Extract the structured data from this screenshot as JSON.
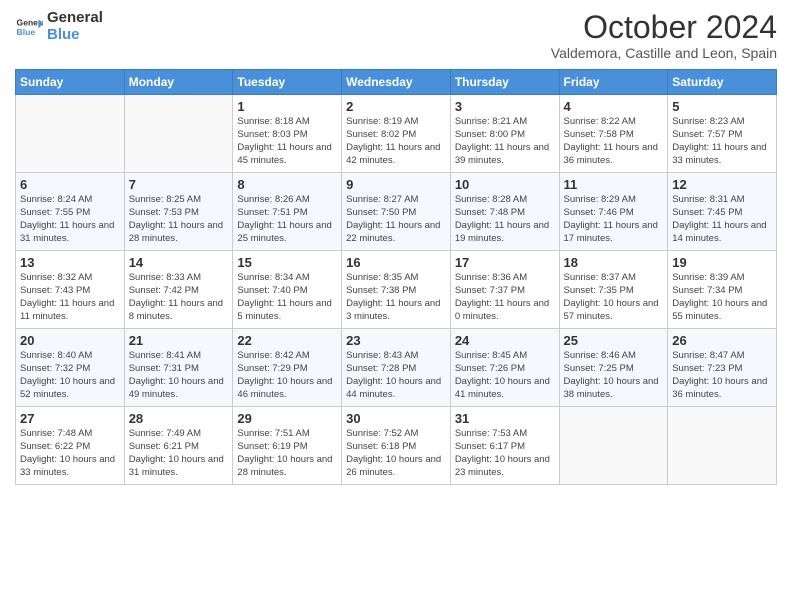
{
  "header": {
    "logo_line1": "General",
    "logo_line2": "Blue",
    "month": "October 2024",
    "location": "Valdemora, Castille and Leon, Spain"
  },
  "days_of_week": [
    "Sunday",
    "Monday",
    "Tuesday",
    "Wednesday",
    "Thursday",
    "Friday",
    "Saturday"
  ],
  "weeks": [
    [
      {
        "day": "",
        "text": ""
      },
      {
        "day": "",
        "text": ""
      },
      {
        "day": "1",
        "text": "Sunrise: 8:18 AM\nSunset: 8:03 PM\nDaylight: 11 hours and 45 minutes."
      },
      {
        "day": "2",
        "text": "Sunrise: 8:19 AM\nSunset: 8:02 PM\nDaylight: 11 hours and 42 minutes."
      },
      {
        "day": "3",
        "text": "Sunrise: 8:21 AM\nSunset: 8:00 PM\nDaylight: 11 hours and 39 minutes."
      },
      {
        "day": "4",
        "text": "Sunrise: 8:22 AM\nSunset: 7:58 PM\nDaylight: 11 hours and 36 minutes."
      },
      {
        "day": "5",
        "text": "Sunrise: 8:23 AM\nSunset: 7:57 PM\nDaylight: 11 hours and 33 minutes."
      }
    ],
    [
      {
        "day": "6",
        "text": "Sunrise: 8:24 AM\nSunset: 7:55 PM\nDaylight: 11 hours and 31 minutes."
      },
      {
        "day": "7",
        "text": "Sunrise: 8:25 AM\nSunset: 7:53 PM\nDaylight: 11 hours and 28 minutes."
      },
      {
        "day": "8",
        "text": "Sunrise: 8:26 AM\nSunset: 7:51 PM\nDaylight: 11 hours and 25 minutes."
      },
      {
        "day": "9",
        "text": "Sunrise: 8:27 AM\nSunset: 7:50 PM\nDaylight: 11 hours and 22 minutes."
      },
      {
        "day": "10",
        "text": "Sunrise: 8:28 AM\nSunset: 7:48 PM\nDaylight: 11 hours and 19 minutes."
      },
      {
        "day": "11",
        "text": "Sunrise: 8:29 AM\nSunset: 7:46 PM\nDaylight: 11 hours and 17 minutes."
      },
      {
        "day": "12",
        "text": "Sunrise: 8:31 AM\nSunset: 7:45 PM\nDaylight: 11 hours and 14 minutes."
      }
    ],
    [
      {
        "day": "13",
        "text": "Sunrise: 8:32 AM\nSunset: 7:43 PM\nDaylight: 11 hours and 11 minutes."
      },
      {
        "day": "14",
        "text": "Sunrise: 8:33 AM\nSunset: 7:42 PM\nDaylight: 11 hours and 8 minutes."
      },
      {
        "day": "15",
        "text": "Sunrise: 8:34 AM\nSunset: 7:40 PM\nDaylight: 11 hours and 5 minutes."
      },
      {
        "day": "16",
        "text": "Sunrise: 8:35 AM\nSunset: 7:38 PM\nDaylight: 11 hours and 3 minutes."
      },
      {
        "day": "17",
        "text": "Sunrise: 8:36 AM\nSunset: 7:37 PM\nDaylight: 11 hours and 0 minutes."
      },
      {
        "day": "18",
        "text": "Sunrise: 8:37 AM\nSunset: 7:35 PM\nDaylight: 10 hours and 57 minutes."
      },
      {
        "day": "19",
        "text": "Sunrise: 8:39 AM\nSunset: 7:34 PM\nDaylight: 10 hours and 55 minutes."
      }
    ],
    [
      {
        "day": "20",
        "text": "Sunrise: 8:40 AM\nSunset: 7:32 PM\nDaylight: 10 hours and 52 minutes."
      },
      {
        "day": "21",
        "text": "Sunrise: 8:41 AM\nSunset: 7:31 PM\nDaylight: 10 hours and 49 minutes."
      },
      {
        "day": "22",
        "text": "Sunrise: 8:42 AM\nSunset: 7:29 PM\nDaylight: 10 hours and 46 minutes."
      },
      {
        "day": "23",
        "text": "Sunrise: 8:43 AM\nSunset: 7:28 PM\nDaylight: 10 hours and 44 minutes."
      },
      {
        "day": "24",
        "text": "Sunrise: 8:45 AM\nSunset: 7:26 PM\nDaylight: 10 hours and 41 minutes."
      },
      {
        "day": "25",
        "text": "Sunrise: 8:46 AM\nSunset: 7:25 PM\nDaylight: 10 hours and 38 minutes."
      },
      {
        "day": "26",
        "text": "Sunrise: 8:47 AM\nSunset: 7:23 PM\nDaylight: 10 hours and 36 minutes."
      }
    ],
    [
      {
        "day": "27",
        "text": "Sunrise: 7:48 AM\nSunset: 6:22 PM\nDaylight: 10 hours and 33 minutes."
      },
      {
        "day": "28",
        "text": "Sunrise: 7:49 AM\nSunset: 6:21 PM\nDaylight: 10 hours and 31 minutes."
      },
      {
        "day": "29",
        "text": "Sunrise: 7:51 AM\nSunset: 6:19 PM\nDaylight: 10 hours and 28 minutes."
      },
      {
        "day": "30",
        "text": "Sunrise: 7:52 AM\nSunset: 6:18 PM\nDaylight: 10 hours and 26 minutes."
      },
      {
        "day": "31",
        "text": "Sunrise: 7:53 AM\nSunset: 6:17 PM\nDaylight: 10 hours and 23 minutes."
      },
      {
        "day": "",
        "text": ""
      },
      {
        "day": "",
        "text": ""
      }
    ]
  ]
}
